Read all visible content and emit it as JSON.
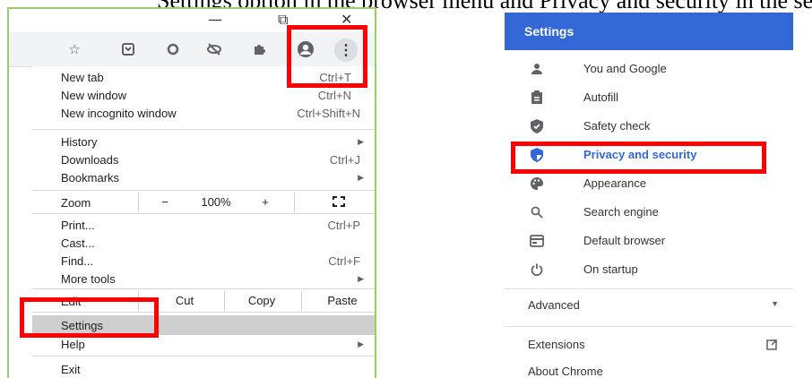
{
  "caption": "Settings option in the browser menu and Privacy and security in the settings page",
  "window": {
    "minimize": "—",
    "restore": "⧉",
    "close": "✕"
  },
  "toolbar": {
    "icons": [
      "star-icon",
      "reading-list-icon",
      "extension-circle-icon",
      "hide-icon",
      "puzzle-icon",
      "profile-icon"
    ],
    "menu_glyph": "⋮"
  },
  "menu": {
    "new_tab": {
      "label": "New tab",
      "shortcut": "Ctrl+T"
    },
    "new_window": {
      "label": "New window",
      "shortcut": "Ctrl+N"
    },
    "new_incognito": {
      "label": "New incognito window",
      "shortcut": "Ctrl+Shift+N"
    },
    "history": {
      "label": "History"
    },
    "downloads": {
      "label": "Downloads",
      "shortcut": "Ctrl+J"
    },
    "bookmarks": {
      "label": "Bookmarks"
    },
    "zoom": {
      "label": "Zoom",
      "minus": "−",
      "value": "100%",
      "plus": "+"
    },
    "print": {
      "label": "Print...",
      "shortcut": "Ctrl+P"
    },
    "cast": {
      "label": "Cast..."
    },
    "find": {
      "label": "Find...",
      "shortcut": "Ctrl+F"
    },
    "more_tools": {
      "label": "More tools"
    },
    "edit": {
      "label": "Edit",
      "cut": "Cut",
      "copy": "Copy",
      "paste": "Paste"
    },
    "settings": {
      "label": "Settings"
    },
    "help": {
      "label": "Help"
    },
    "exit": {
      "label": "Exit"
    }
  },
  "settings_page": {
    "title": "Settings",
    "items": [
      {
        "label": "You and Google",
        "icon": "person-icon"
      },
      {
        "label": "Autofill",
        "icon": "clipboard-icon"
      },
      {
        "label": "Safety check",
        "icon": "shield-check-icon"
      },
      {
        "label": "Privacy and security",
        "icon": "shield-icon",
        "active": true
      },
      {
        "label": "Appearance",
        "icon": "palette-icon"
      },
      {
        "label": "Search engine",
        "icon": "search-icon"
      },
      {
        "label": "Default browser",
        "icon": "browser-icon"
      },
      {
        "label": "On startup",
        "icon": "power-icon"
      }
    ],
    "advanced": "Advanced",
    "extensions": "Extensions",
    "about": "About Chrome"
  },
  "colors": {
    "highlight": "#ff0000",
    "header": "#3367d6",
    "frame": "#9acd63"
  }
}
